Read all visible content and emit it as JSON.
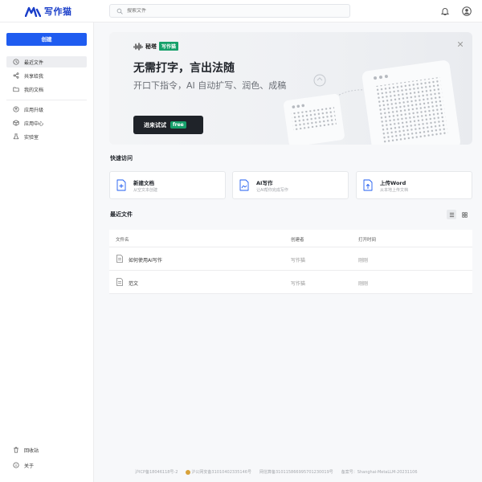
{
  "app": {
    "name": "写作猫",
    "brand_color": "#1a3ec9"
  },
  "search": {
    "placeholder": "搜索文件"
  },
  "sidebar": {
    "create_label": "创建",
    "items": [
      {
        "label": "最近文件",
        "icon": "clock-icon",
        "active": true
      },
      {
        "label": "共享给我",
        "icon": "share-icon",
        "active": false
      },
      {
        "label": "我的文档",
        "icon": "folder-icon",
        "active": false
      },
      {
        "label": "应用升级",
        "icon": "upgrade-icon",
        "active": false
      },
      {
        "label": "应用中心",
        "icon": "cube-icon",
        "active": false
      },
      {
        "label": "实验室",
        "icon": "flask-icon",
        "active": false
      }
    ],
    "bottom_items": [
      {
        "label": "回收站",
        "icon": "trash-icon"
      },
      {
        "label": "关于",
        "icon": "info-icon"
      }
    ]
  },
  "banner": {
    "brand_name": "秘塔",
    "brand_tag": "写作猫",
    "title": "无需打字，言出法随",
    "subtitle": "开口下指令，AI 自动扩写、润色、成稿",
    "cta_label": "进来试试",
    "cta_badge": "free",
    "accent": "#16a06a"
  },
  "quick_access": {
    "title": "快速访问",
    "cards": [
      {
        "title": "新建文档",
        "desc": "从空文本创建",
        "icon": "new-doc-icon"
      },
      {
        "title": "AI写作",
        "desc": "让AI帮你完成写作",
        "icon": "ai-write-icon"
      },
      {
        "title": "上传Word",
        "desc": "从本地上传文档",
        "icon": "upload-word-icon"
      }
    ]
  },
  "recent": {
    "title": "最近文件",
    "columns": {
      "name": "文件名",
      "creator": "创建者",
      "opened": "打开时间"
    },
    "rows": [
      {
        "name": "如何使用AI写作",
        "creator": "写作猫",
        "opened": "刚刚"
      },
      {
        "name": "范文",
        "creator": "写作猫",
        "opened": "刚刚"
      }
    ]
  },
  "footer": {
    "icp": "沪ICP备18046118号-2",
    "police": "沪公网安备31010402335146号",
    "service": "网信算备310115866995701230019号",
    "record": "备案号：Shanghai-MetaLLM-20231106"
  }
}
